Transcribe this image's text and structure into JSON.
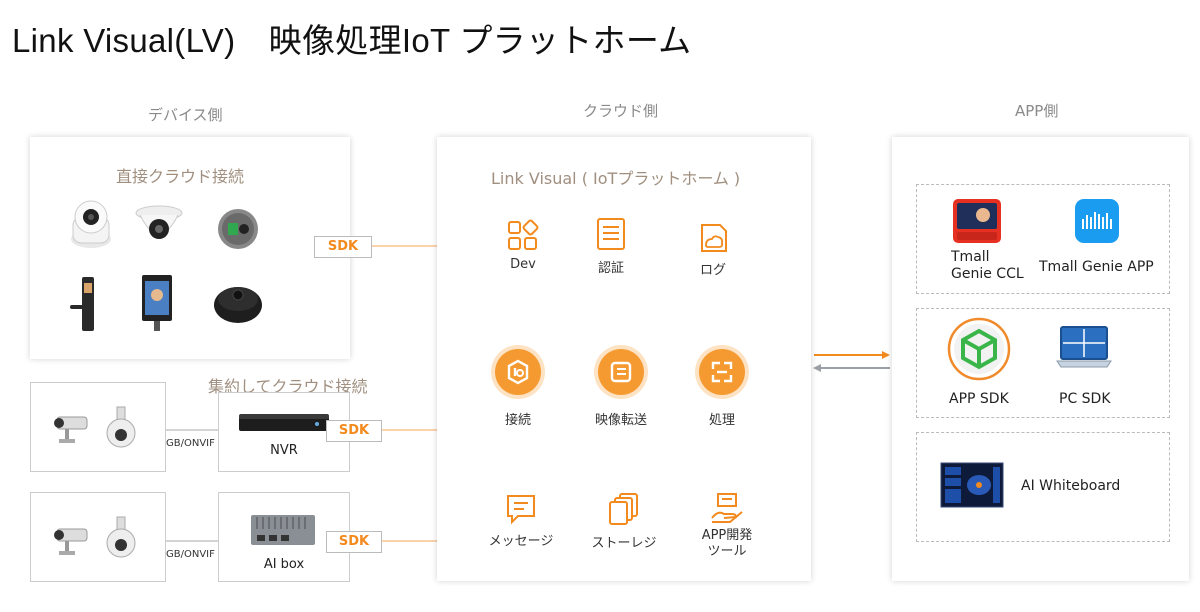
{
  "title": "Link Visual(LV)　映像処理IoT プラットホーム",
  "columns": {
    "device": "デバイス側",
    "cloud": "クラウド側",
    "app": "APP側"
  },
  "device": {
    "direct_title": "直接クラウド接続",
    "aggregate_title": "集約してクラウド接続",
    "protocol": "GB/ONVIF",
    "nvr_label": "NVR",
    "aibox_label": "AI box",
    "sdk": "SDK"
  },
  "cloud": {
    "platform_title": "Link Visual ( IoTプラットホーム )",
    "features": [
      {
        "label": "Dev",
        "icon": "dev-grid-icon"
      },
      {
        "label": "認証",
        "icon": "auth-document-icon"
      },
      {
        "label": "ログ",
        "icon": "log-cloud-icon"
      },
      {
        "label": "接続",
        "icon": "connect-icon"
      },
      {
        "label": "映像転送",
        "icon": "video-transfer-icon"
      },
      {
        "label": "処理",
        "icon": "process-icon"
      },
      {
        "label": "メッセージ",
        "icon": "message-icon"
      },
      {
        "label": "ストーレジ",
        "icon": "storage-icon"
      },
      {
        "label": "APP開発\nツール",
        "icon": "app-dev-tools-icon"
      }
    ]
  },
  "app": {
    "tmall_ccl": "Tmall\nGenie CCL",
    "tmall_app": "Tmall Genie APP",
    "app_sdk": "APP SDK",
    "pc_sdk": "PC SDK",
    "ai_whiteboard": "AI Whiteboard"
  },
  "colors": {
    "accent": "#f28a1e",
    "arrow_back": "#9aa0a6",
    "border": "#bbbbbb"
  }
}
